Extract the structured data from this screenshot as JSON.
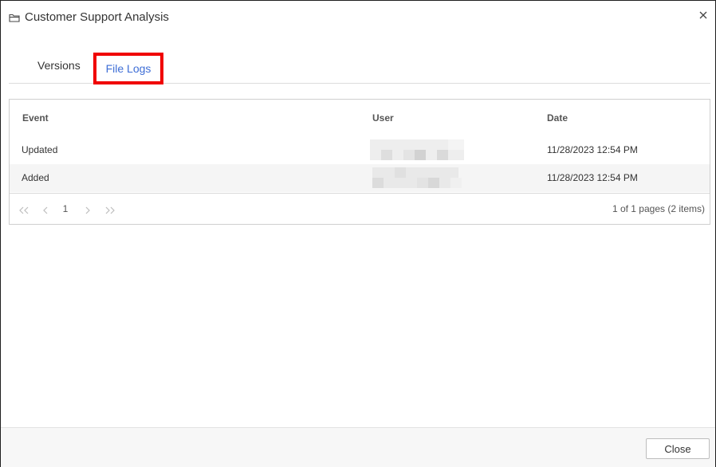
{
  "dialog": {
    "title": "Customer Support Analysis",
    "title_icon": "folder-icon",
    "close_icon": "close-icon"
  },
  "tabs": [
    {
      "label": "Versions",
      "active": false
    },
    {
      "label": "File Logs",
      "active": true
    }
  ],
  "grid": {
    "columns": [
      "Event",
      "User",
      "Date"
    ],
    "rows": [
      {
        "event": "Updated",
        "user": "",
        "date": "11/28/2023 12:54 PM"
      },
      {
        "event": "Added",
        "user": "",
        "date": "11/28/2023 12:54 PM"
      }
    ]
  },
  "pager": {
    "first_icon": "double-chevron-left-icon",
    "prev_icon": "chevron-left-icon",
    "page": "1",
    "next_icon": "chevron-right-icon",
    "last_icon": "double-chevron-right-icon",
    "info": "1 of 1 pages (2 items)"
  },
  "footer": {
    "close_label": "Close"
  },
  "colors": {
    "accent": "#3e6ed6",
    "highlight": "#f00000"
  }
}
